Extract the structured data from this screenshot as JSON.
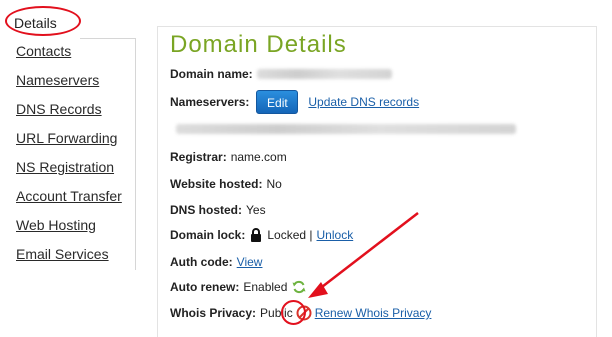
{
  "sidebar": {
    "active_tab": "Details",
    "items": [
      {
        "label": "Contacts"
      },
      {
        "label": "Nameservers"
      },
      {
        "label": "DNS Records"
      },
      {
        "label": "URL Forwarding"
      },
      {
        "label": "NS Registration"
      },
      {
        "label": "Account Transfer"
      },
      {
        "label": "Web Hosting"
      },
      {
        "label": "Email Services"
      }
    ]
  },
  "main": {
    "title": "Domain Details",
    "domain_name_label": "Domain name:",
    "nameservers_label": "Nameservers:",
    "edit_label": "Edit",
    "update_dns_label": "Update DNS records",
    "registrar_label": "Registrar:",
    "registrar_value": "name.com",
    "website_hosted_label": "Website hosted:",
    "website_hosted_value": "No",
    "dns_hosted_label": "DNS hosted:",
    "dns_hosted_value": "Yes",
    "domain_lock_label": "Domain lock:",
    "domain_lock_value": "Locked |",
    "unlock_label": "Unlock",
    "auth_code_label": "Auth code:",
    "auth_code_link": "View",
    "auto_renew_label": "Auto renew:",
    "auto_renew_value": "Enabled",
    "whois_label": "Whois Privacy:",
    "whois_value": "Public",
    "renew_whois_label": "Renew Whois Privacy"
  },
  "icons": {
    "lock": "lock-icon",
    "refresh": "refresh-icon",
    "privacy_off": "ban-icon"
  },
  "colors": {
    "title_green": "#7aa524",
    "link_blue": "#1a5fa8",
    "button_blue": "#1a73c9",
    "annotation_red": "#e2101d"
  }
}
